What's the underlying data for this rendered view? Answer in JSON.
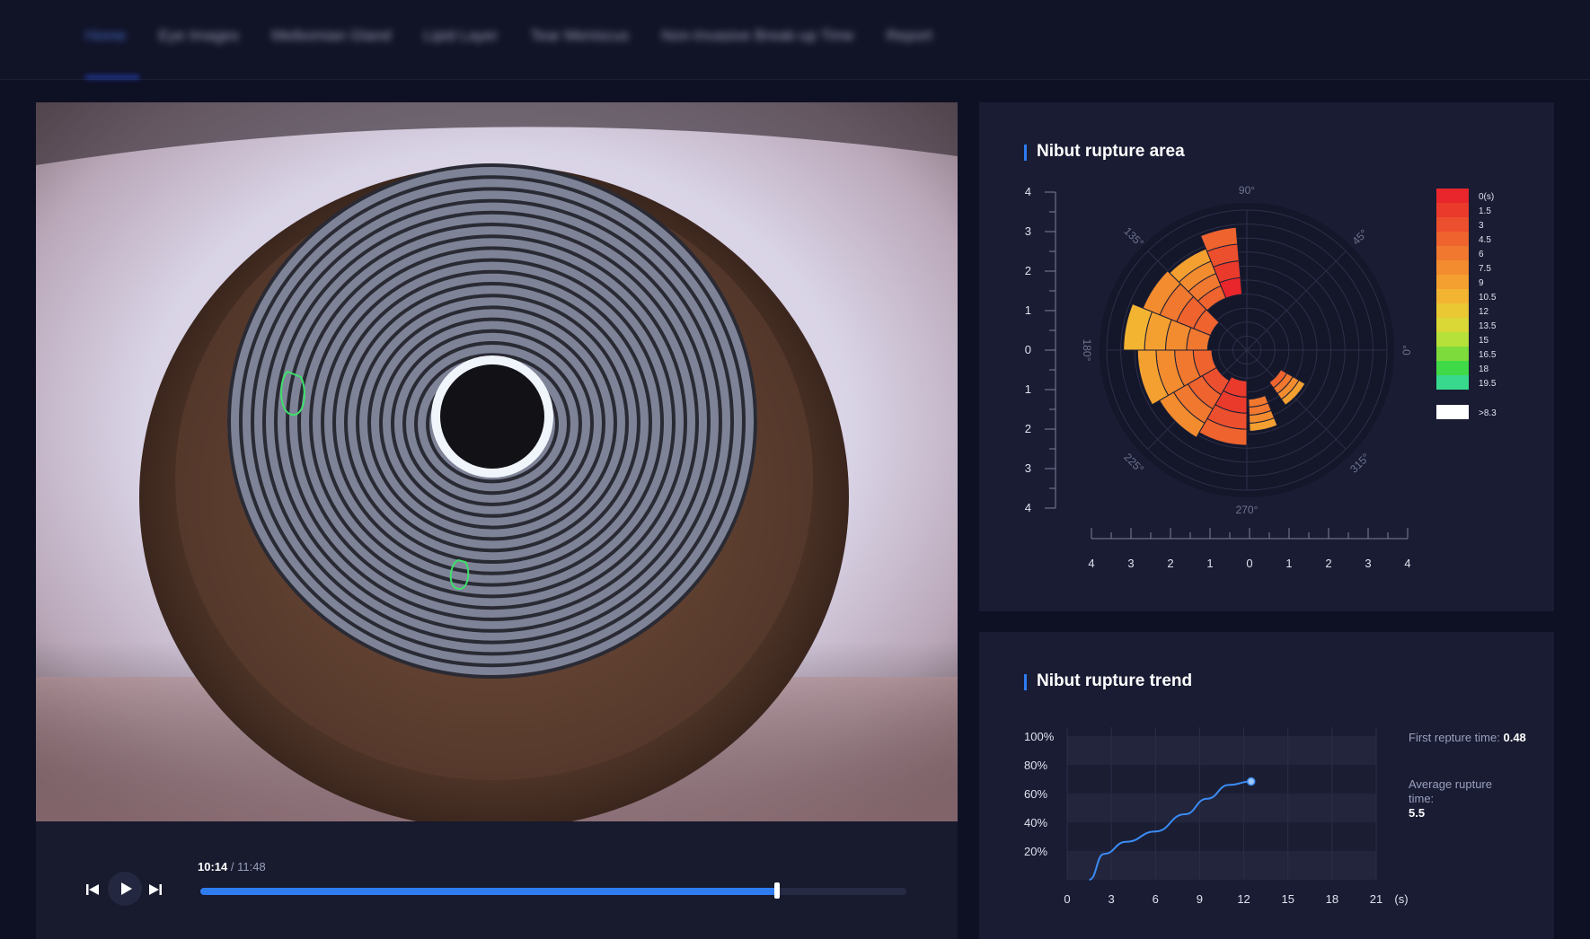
{
  "nav": {
    "items": [
      "Home",
      "Eye Images",
      "Meibomian Gland",
      "Lipid Layer",
      "Tear Meniscus",
      "Non-Invasive Break-up Time",
      "Report"
    ]
  },
  "player": {
    "current_time": "10:14",
    "separator": "/",
    "total_time": "11:48",
    "progress_fraction": 0.817
  },
  "area_panel": {
    "title": "Nibut rupture area",
    "y_ticks": [
      "4",
      "3",
      "2",
      "1",
      "0",
      "1",
      "2",
      "3",
      "4"
    ],
    "x_ticks": [
      "4",
      "3",
      "2",
      "1",
      "0",
      "1",
      "2",
      "3",
      "4"
    ],
    "angle_labels": [
      "90°",
      "45°",
      "0°",
      "315°",
      "270°",
      "225°",
      "180°",
      "135°"
    ],
    "legend": {
      "labels": [
        "0(s)",
        "1.5",
        "3",
        "4.5",
        "6",
        "7.5",
        "9",
        "10.5",
        "12",
        "13.5",
        "15",
        "16.5",
        "18",
        "19.5"
      ],
      "colors": [
        "#e8262b",
        "#ea3a2c",
        "#ec4f2d",
        "#ee632e",
        "#f0782f",
        "#f28c2f",
        "#f4a030",
        "#f3b432",
        "#e9c834",
        "#d9d836",
        "#b6e13a",
        "#7ddc3c",
        "#40d948",
        "#38d98c"
      ],
      "overflow_label": ">8.3"
    }
  },
  "trend_panel": {
    "title": "Nibut rupture trend",
    "y_ticks": [
      "100%",
      "80%",
      "60%",
      "40%",
      "20%"
    ],
    "x_ticks": [
      "0",
      "3",
      "6",
      "9",
      "12",
      "15",
      "18",
      "21"
    ],
    "x_unit": "(s)",
    "first_label": "First repture time:",
    "first_value": "0.48",
    "avg_label": "Average rupture time:",
    "avg_value": "5.5"
  },
  "chart_data": [
    {
      "type": "line",
      "title": "Nibut rupture trend",
      "xlabel": "(s)",
      "ylabel": "",
      "xlim": [
        0,
        21
      ],
      "ylim": [
        0,
        100
      ],
      "x": [
        1.5,
        2.5,
        4.0,
        6.0,
        8.0,
        9.5,
        11.0,
        12.5
      ],
      "y": [
        0,
        15,
        22,
        28,
        38,
        47,
        55,
        57
      ]
    },
    {
      "type": "heatmap",
      "title": "Nibut rupture area",
      "xlim": [
        -4,
        4
      ],
      "ylim": [
        -4,
        4
      ],
      "polar_sectors": [
        {
          "a0": 95,
          "a1": 112,
          "r0": 0.4,
          "r1": 0.88,
          "v": 0.5
        },
        {
          "a0": 112,
          "a1": 135,
          "r0": 0.4,
          "r1": 0.78,
          "v": 5
        },
        {
          "a0": 135,
          "a1": 158,
          "r0": 0.28,
          "r1": 0.8,
          "v": 4
        },
        {
          "a0": 158,
          "a1": 180,
          "r0": 0.28,
          "r1": 0.88,
          "v": 6.5
        },
        {
          "a0": 180,
          "a1": 210,
          "r0": 0.25,
          "r1": 0.78,
          "v": 5
        },
        {
          "a0": 210,
          "a1": 240,
          "r0": 0.25,
          "r1": 0.72,
          "v": 3.5
        },
        {
          "a0": 240,
          "a1": 270,
          "r0": 0.22,
          "r1": 0.68,
          "v": 1
        },
        {
          "a0": 272,
          "a1": 292,
          "r0": 0.35,
          "r1": 0.58,
          "v": 5.5
        },
        {
          "a0": 305,
          "a1": 330,
          "r0": 0.28,
          "r1": 0.48,
          "v": 5
        }
      ]
    }
  ]
}
